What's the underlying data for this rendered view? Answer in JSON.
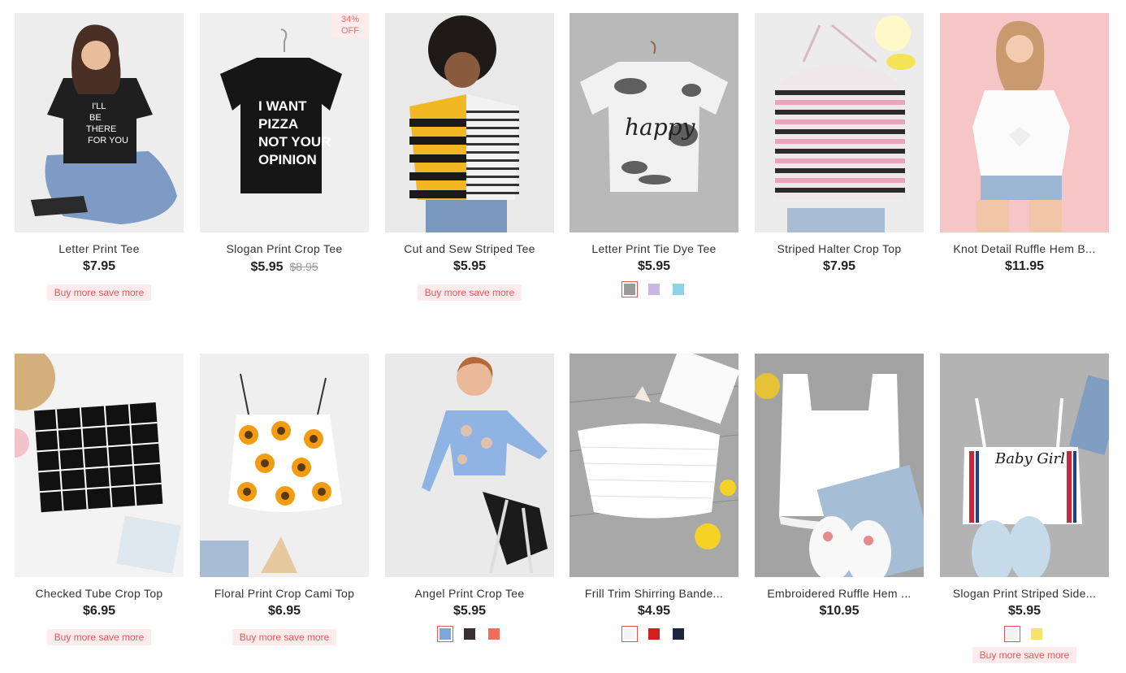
{
  "products": [
    {
      "title": "Letter Print Tee",
      "price": "$7.95",
      "old_price": "",
      "badge": "",
      "promo": "Buy more save more",
      "swatches": [],
      "image": "woman-black-letter-tee",
      "bg": "#ededed"
    },
    {
      "title": "Slogan Print Crop Tee",
      "price": "$5.95",
      "old_price": "$8.95",
      "badge": "34%\nOFF",
      "promo": "",
      "swatches": [],
      "image": "black-slogan-tee-hanger",
      "bg": "#efefef"
    },
    {
      "title": "Cut and Sew Striped Tee",
      "price": "$5.95",
      "old_price": "",
      "badge": "",
      "promo": "Buy more save more",
      "swatches": [],
      "image": "woman-yellow-striped-tee",
      "bg": "#e9e9e9"
    },
    {
      "title": "Letter Print Tie Dye Tee",
      "price": "$5.95",
      "old_price": "",
      "badge": "",
      "promo": "",
      "swatches": [
        "#9a9a9a",
        "#c9b7e3",
        "#8fd3e8"
      ],
      "image": "tie-dye-happy-tee",
      "bg": "#b9b9b9"
    },
    {
      "title": "Striped Halter Crop Top",
      "price": "$7.95",
      "old_price": "",
      "badge": "",
      "promo": "",
      "swatches": [],
      "image": "pink-striped-halter",
      "bg": "#ececec"
    },
    {
      "title": "Knot Detail Ruffle Hem B...",
      "price": "$11.95",
      "old_price": "",
      "badge": "",
      "promo": "",
      "swatches": [],
      "image": "woman-white-knot-blouse",
      "bg": "#f6c6c6"
    },
    {
      "title": "Checked Tube Crop Top",
      "price": "$6.95",
      "old_price": "",
      "badge": "",
      "promo": "Buy more save more",
      "swatches": [],
      "image": "black-grid-tube-top",
      "bg": "#f3f3f3"
    },
    {
      "title": "Floral Print Crop Cami Top",
      "price": "$6.95",
      "old_price": "",
      "badge": "",
      "promo": "Buy more save more",
      "swatches": [],
      "image": "sunflower-cami",
      "bg": "#efefef"
    },
    {
      "title": "Angel Print Crop Tee",
      "price": "$5.95",
      "old_price": "",
      "badge": "",
      "promo": "",
      "swatches": [
        "#7fa6d8",
        "#3a2f33",
        "#f36d5e"
      ],
      "image": "woman-angel-crop-tee",
      "bg": "#eaeaea"
    },
    {
      "title": "Frill Trim Shirring Bande...",
      "price": "$4.95",
      "old_price": "",
      "badge": "",
      "promo": "",
      "swatches": [
        "#f4f4f8",
        "#d21f1f",
        "#1b2540"
      ],
      "image": "white-shirred-bandeau",
      "bg": "#a8a8a8"
    },
    {
      "title": "Embroidered Ruffle Hem ...",
      "price": "$10.95",
      "old_price": "",
      "badge": "",
      "promo": "",
      "swatches": [],
      "image": "white-ruffle-tank",
      "bg": "#a3a3a3"
    },
    {
      "title": "Slogan Print Striped Side...",
      "price": "$5.95",
      "old_price": "",
      "badge": "",
      "promo": "Buy more save more",
      "swatches": [
        "#f2f2f2",
        "#f7e26b"
      ],
      "image": "baby-girl-cami",
      "bg": "#b3b3b3"
    }
  ],
  "colors": {
    "accent": "#e45858",
    "promo_bg": "#fdeceb"
  }
}
